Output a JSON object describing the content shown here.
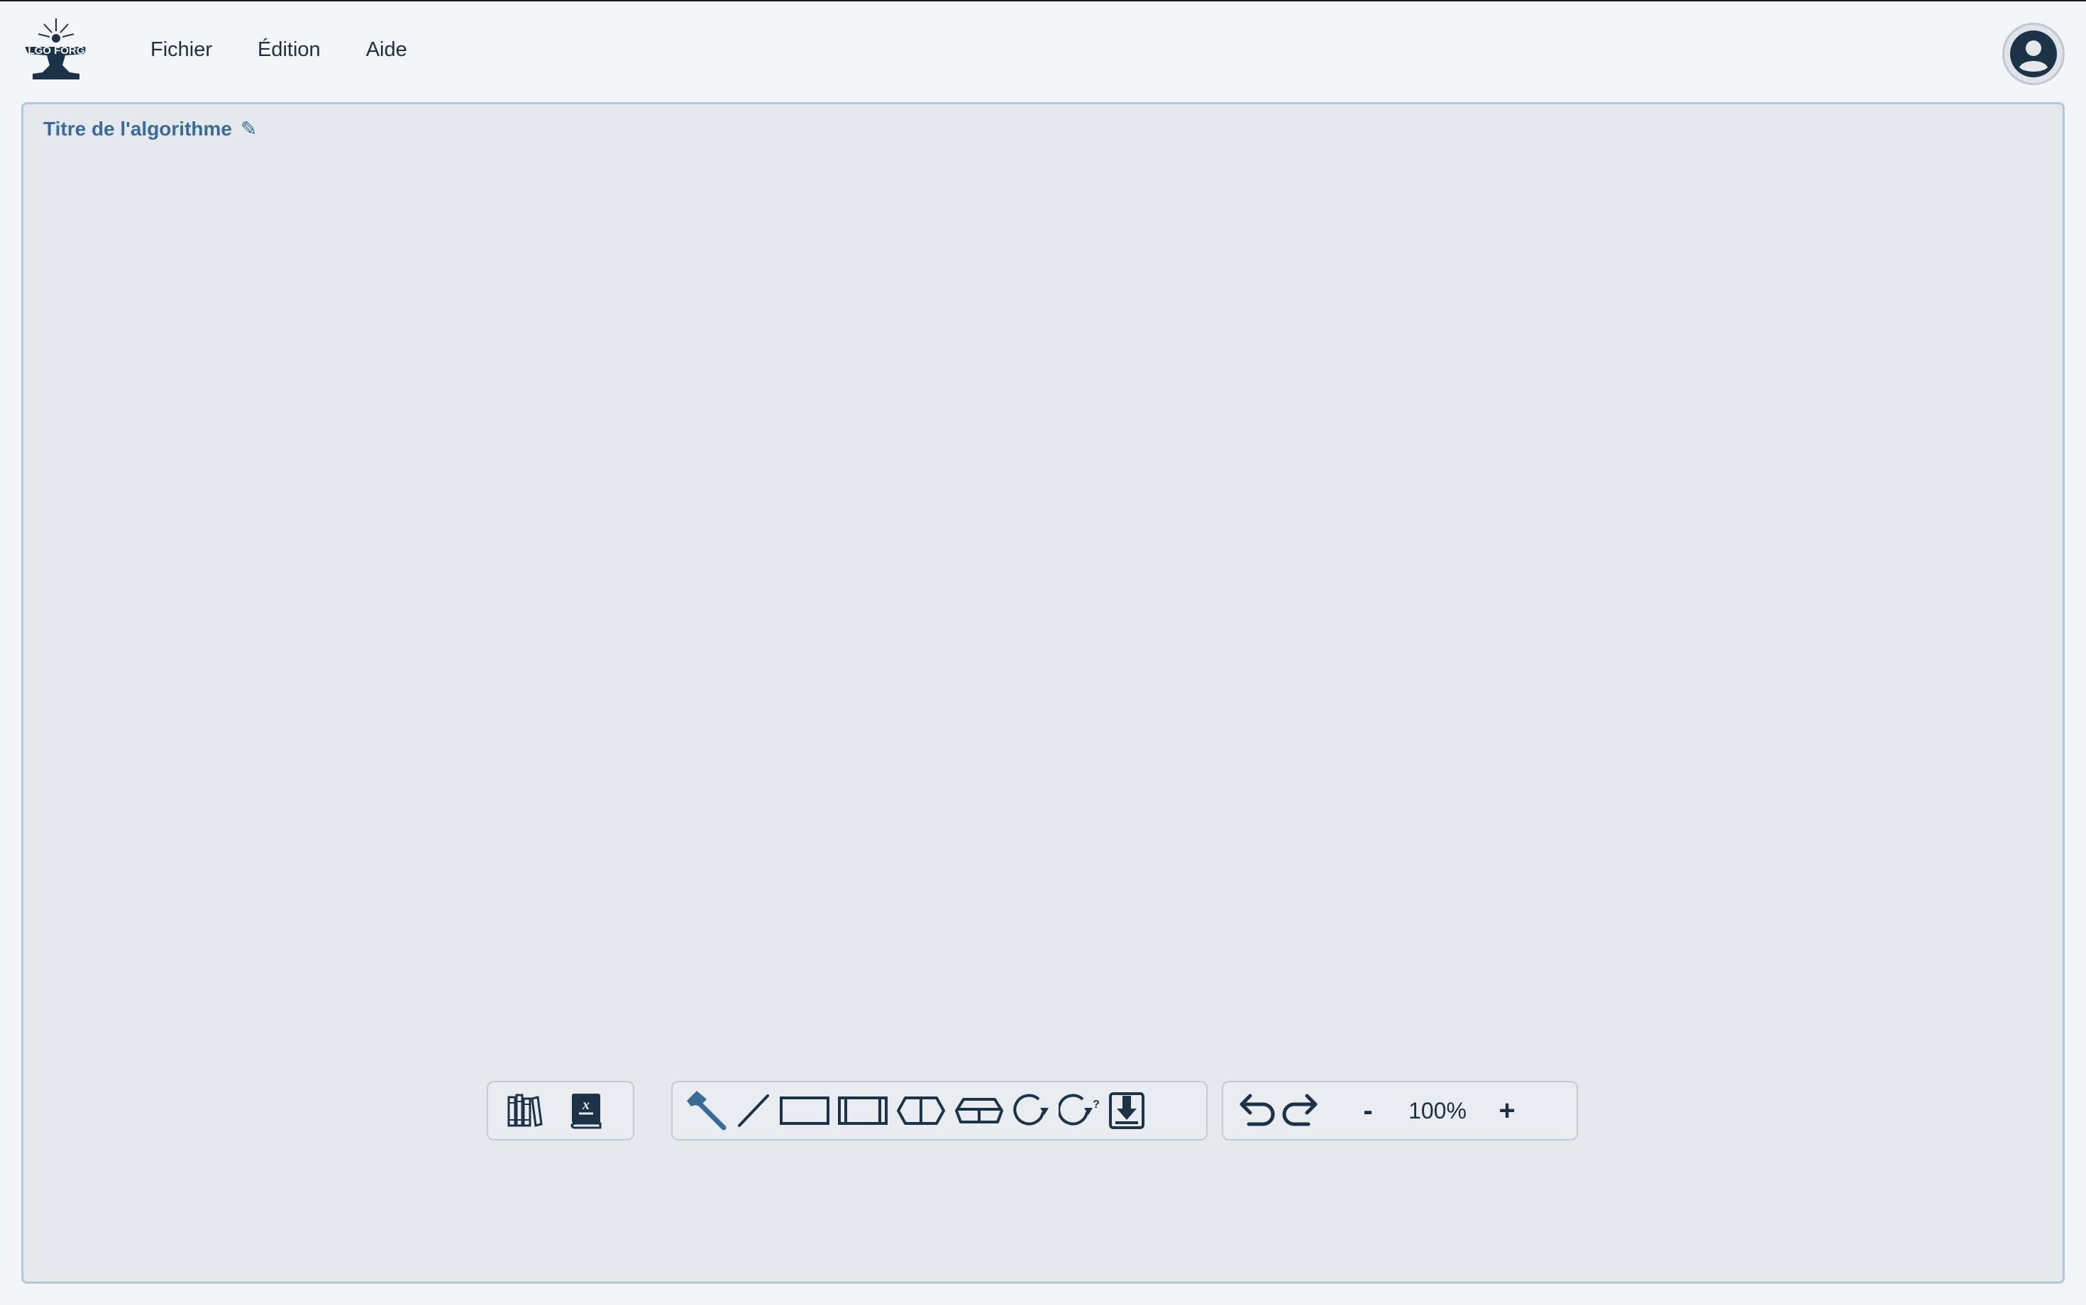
{
  "header": {
    "logo_text": "ALGO FORGE",
    "menu": [
      {
        "label": "Fichier"
      },
      {
        "label": "Édition"
      },
      {
        "label": "Aide"
      }
    ],
    "account_icon": "user-circle-icon"
  },
  "canvas": {
    "title": "Titre de l'algorithme",
    "title_edit_icon": "pencil-icon"
  },
  "toolbars": {
    "library": [
      {
        "icon": "books-library-icon"
      },
      {
        "icon": "dictionary-book-icon"
      }
    ],
    "shapes": [
      {
        "icon": "hammer-icon"
      },
      {
        "icon": "line-tool-icon"
      },
      {
        "icon": "rectangle-tool-icon"
      },
      {
        "icon": "subprocess-rectangle-icon"
      },
      {
        "icon": "hexagon-condition-icon"
      },
      {
        "icon": "trapezoid-choice-icon"
      },
      {
        "icon": "loop-circle-icon"
      },
      {
        "icon": "conditional-loop-icon"
      },
      {
        "icon": "exit-download-icon"
      }
    ],
    "history": {
      "undo_icon": "undo-icon",
      "redo_icon": "redo-icon",
      "zoom_out_label": "-",
      "zoom_value": "100%",
      "zoom_in_label": "+"
    }
  },
  "colors": {
    "page_bg": "#f3f5f8",
    "canvas_bg": "#e5e8ed",
    "accent": "#3a6b97",
    "ink": "#1c2f40"
  }
}
